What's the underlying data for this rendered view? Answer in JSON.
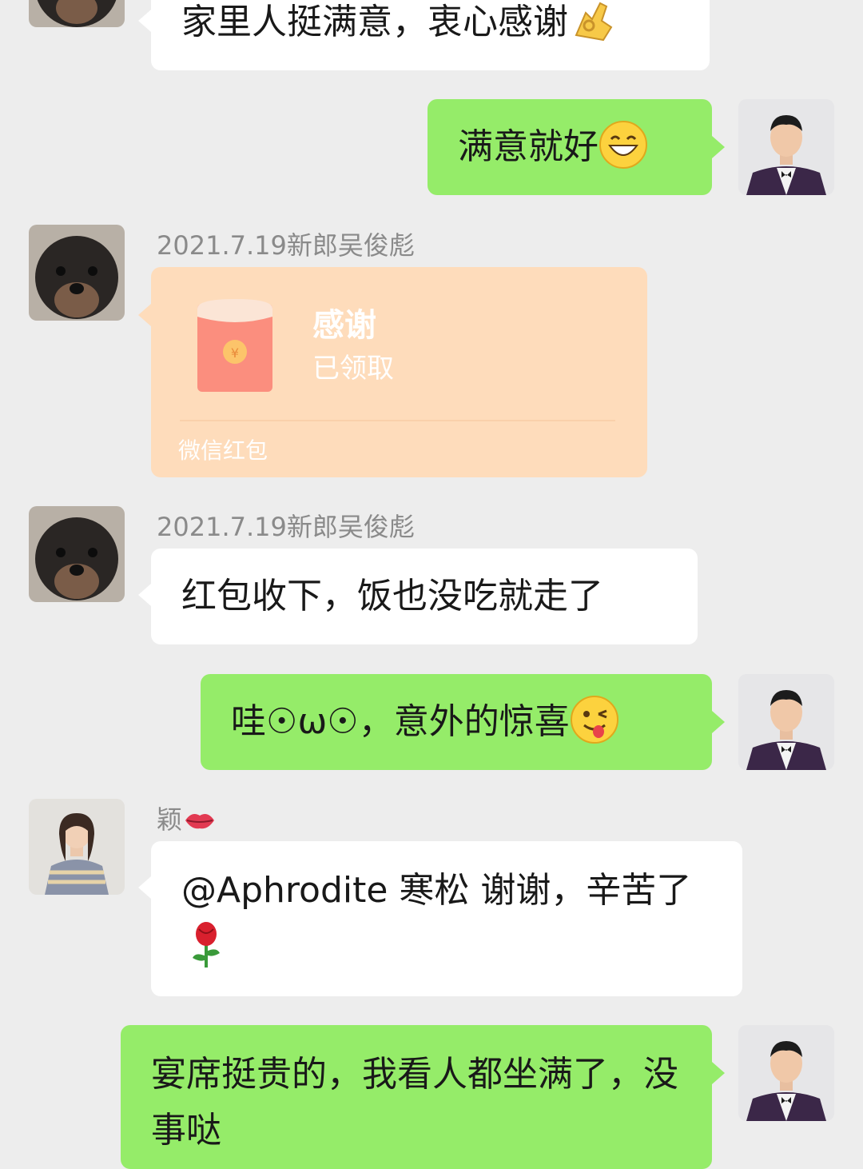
{
  "messages": [
    {
      "text": "家里人挺满意，衷心感谢",
      "emoji": "ok-hand-emoji"
    },
    {
      "text": "满意就好",
      "emoji": "grinning-face-emoji"
    },
    {
      "sender": "2021.7.19新郎吴俊彪",
      "red_packet": {
        "title": "感谢",
        "status": "已领取",
        "footer": "微信红包"
      }
    },
    {
      "sender": "2021.7.19新郎吴俊彪",
      "text": "红包收下，饭也没吃就走了"
    },
    {
      "text": "哇☉ω☉，意外的惊喜",
      "emoji": "winking-tongue-face-emoji"
    },
    {
      "sender": "颖",
      "sender_emoji": "lips-emoji",
      "text": "@Aphrodite 寒松  谢谢，辛苦了",
      "emoji": "rose-emoji"
    },
    {
      "text": "宴席挺贵的，我看人都坐满了，没事哒"
    }
  ],
  "colors": {
    "background": "#ededed",
    "incoming_bubble": "#ffffff",
    "outgoing_bubble": "#95ec69",
    "red_packet": "#fedcbb",
    "sender_name": "#8a8a8a"
  }
}
